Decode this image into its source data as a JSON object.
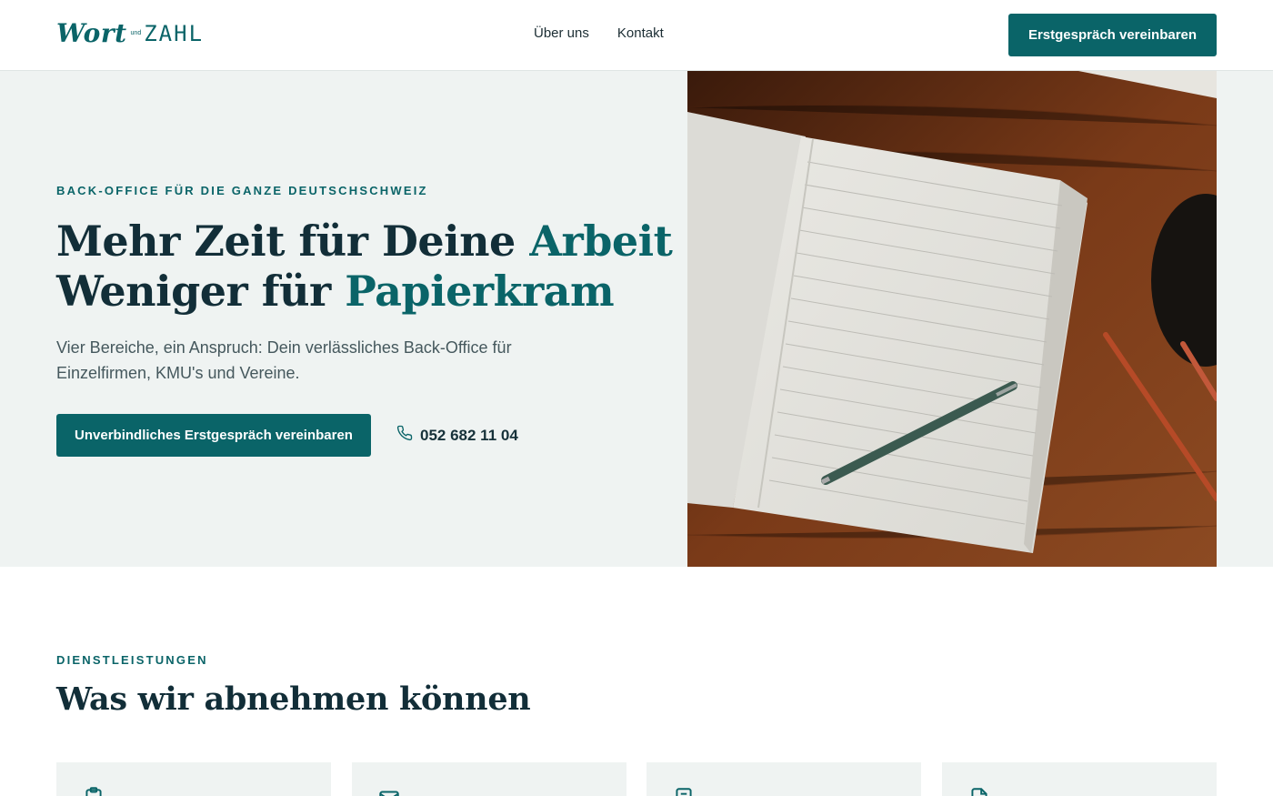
{
  "brand": {
    "logo_word1": "Wort",
    "logo_und": "und",
    "logo_word2": "ZAHL"
  },
  "nav": {
    "items": [
      "Über uns",
      "Kontakt"
    ]
  },
  "header": {
    "cta_label": "Erstgespräch vereinbaren"
  },
  "hero": {
    "eyebrow": "BACK-OFFICE FÜR DIE GANZE DEUTSCHSCHWEIZ",
    "headline_line1_prefix": "Mehr Zeit für Deine ",
    "headline_line1_accent": "Arbeit",
    "headline_line2_prefix": "Weniger für ",
    "headline_line2_accent": "Papierkram",
    "lead": "Vier Bereiche, ein Anspruch: Dein verlässliches Back-Office für Einzelfirmen, KMU's und Vereine.",
    "cta_label": "Unverbindliches Erstgespräch vereinbaren",
    "phone": "052 682 11 04",
    "phone_icon": "phone-icon",
    "image": "notebook-pen-desk-photo"
  },
  "services": {
    "eyebrow": "DIENSTLEISTUNGEN",
    "title": "Was wir abnehmen können",
    "card_icons": [
      "clipboard-icon",
      "envelope-icon",
      "document-icon",
      "file-check-icon"
    ]
  },
  "colors": {
    "accent": "#0a6468",
    "hero_bg": "#eff3f2",
    "heading": "#122e38",
    "text_muted": "#45585d"
  }
}
